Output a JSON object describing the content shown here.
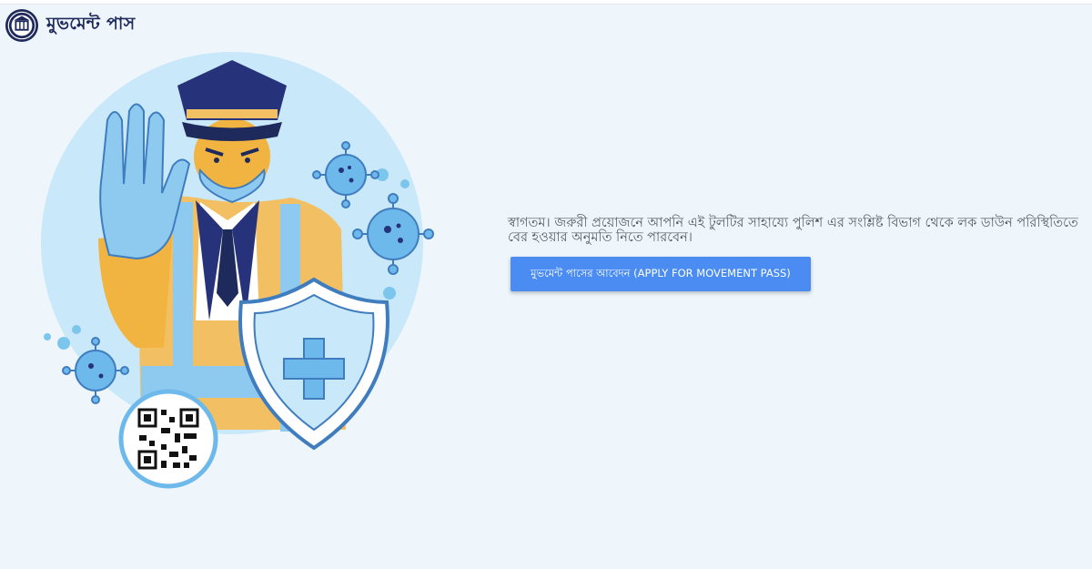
{
  "header": {
    "logo_icon": "police-emblem-icon",
    "title": "মুভমেন্ট পাস"
  },
  "illustration": {
    "subject": "police-officer-illustration",
    "icons": [
      "virus-icon",
      "shield-plus-icon",
      "qr-code-icon"
    ]
  },
  "main": {
    "welcome_text": "স্বাগতম। জরুরী প্রয়োজনে আপনি এই টুলটির সাহায্যে পুলিশ এর সংশ্লিষ্ট বিভাগ থেকে লক ডাউন পরিস্থিতিতে বের হওয়ার অনুমতি নিতে পারবেন।",
    "apply_button_label": "মুভমেন্ট পাসের আবেদন (APPLY FOR MOVEMENT PASS)"
  },
  "colors": {
    "background": "#eef6fb",
    "brand_navy": "#1f2a5c",
    "button_blue": "#4a8cf1",
    "light_blue": "#c9e8fa"
  }
}
